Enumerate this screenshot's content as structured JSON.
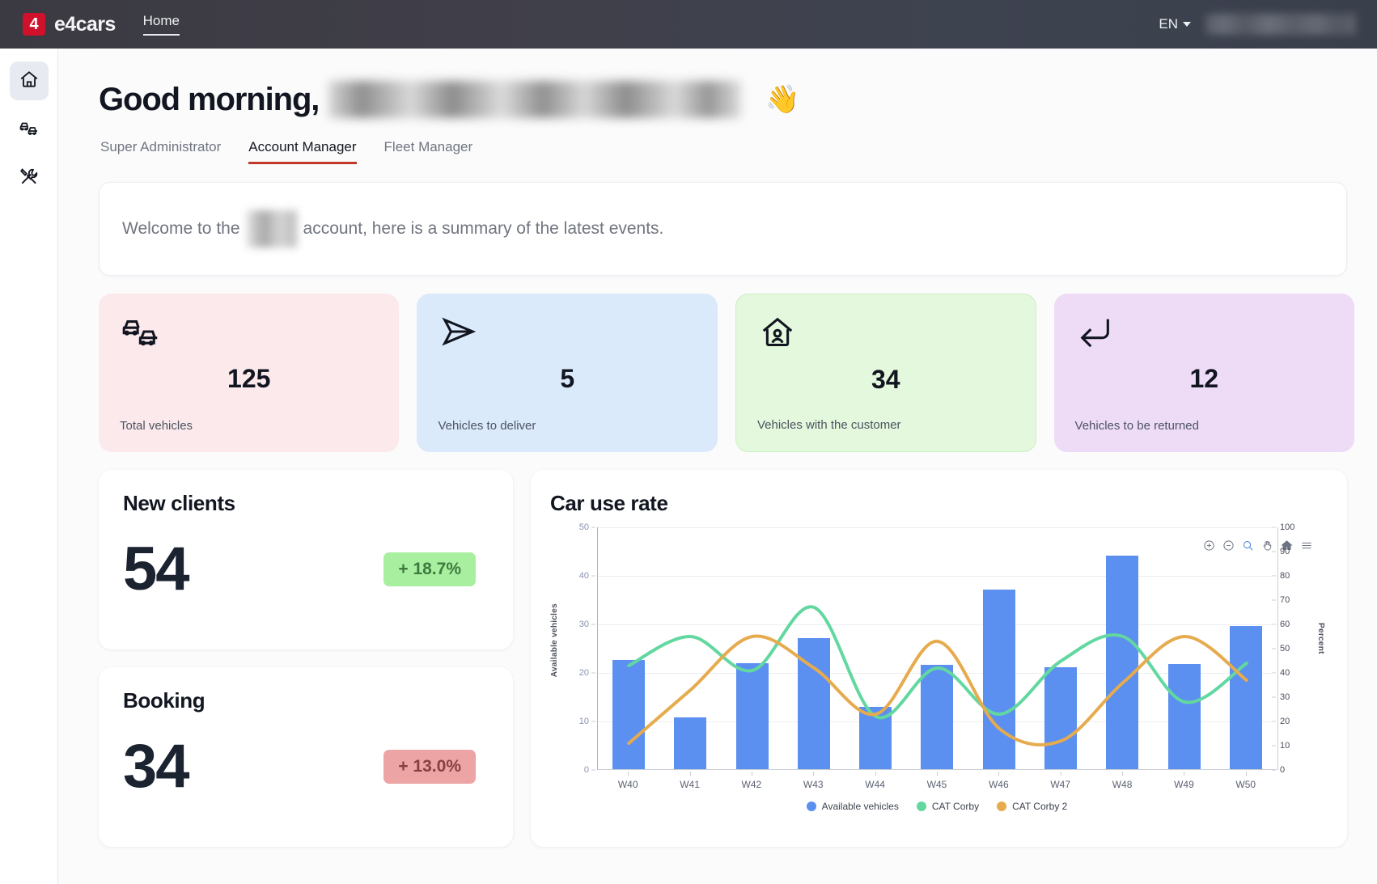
{
  "topbar": {
    "logo_text": "4",
    "brand": "e4cars",
    "nav_home": "Home",
    "language": "EN",
    "user_name_redacted": ""
  },
  "sidebar": {
    "items": [
      {
        "name": "home",
        "icon": "home-icon",
        "active": true
      },
      {
        "name": "vehicles",
        "icon": "cars-icon",
        "active": false
      },
      {
        "name": "tools",
        "icon": "tools-icon",
        "active": false
      }
    ]
  },
  "greeting": {
    "text": "Good morning,",
    "name_redacted": "",
    "wave_emoji": "👋"
  },
  "tabs": [
    {
      "label": "Super Administrator",
      "active": false
    },
    {
      "label": "Account Manager",
      "active": true
    },
    {
      "label": "Fleet Manager",
      "active": false
    }
  ],
  "welcome": {
    "prefix": "Welcome to the",
    "account_redacted": "",
    "suffix": "account, here is a summary of the latest events."
  },
  "kpis": [
    {
      "value": "125",
      "label": "Total vehicles",
      "icon": "cars-icon",
      "color": "#fbe9ec"
    },
    {
      "value": "5",
      "label": "Vehicles to deliver",
      "icon": "send-icon",
      "color": "#dbeafb"
    },
    {
      "value": "34",
      "label": "Vehicles with the customer",
      "icon": "home-person-icon",
      "color": "#e3f8dd"
    },
    {
      "value": "12",
      "label": "Vehicles to be returned",
      "icon": "return-icon",
      "color": "#eedcf7"
    }
  ],
  "stats": [
    {
      "title": "New clients",
      "value": "54",
      "delta": "+ 18.7%",
      "trend": "up"
    },
    {
      "title": "Booking",
      "value": "34",
      "delta": "+ 13.0%",
      "trend": "down"
    }
  ],
  "chart_card": {
    "title": "Car use rate",
    "toolbar": [
      {
        "name": "zoom-in-icon",
        "label": "Zoom In"
      },
      {
        "name": "zoom-out-icon",
        "label": "Zoom Out"
      },
      {
        "name": "selection-zoom-icon",
        "label": "Selection Zoom"
      },
      {
        "name": "panning-icon",
        "label": "Panning"
      },
      {
        "name": "reset-home-icon",
        "label": "Reset Zoom"
      },
      {
        "name": "menu-icon",
        "label": "Menu"
      }
    ]
  },
  "chart_data": {
    "type": "bar",
    "title": "Car use rate",
    "xlabel": "",
    "ylabel": "Available vehicles",
    "y2label": "Percent",
    "ylim": [
      0,
      50
    ],
    "y2lim": [
      0,
      100
    ],
    "yticks": [
      0,
      10,
      20,
      30,
      40,
      50
    ],
    "y2ticks": [
      0,
      10,
      20,
      30,
      40,
      50,
      60,
      70,
      80,
      90,
      100
    ],
    "grid": true,
    "legend_position": "bottom",
    "categories": [
      "W40",
      "W41",
      "W42",
      "W43",
      "W44",
      "W45",
      "W46",
      "W47",
      "W48",
      "W49",
      "W50"
    ],
    "series": [
      {
        "name": "Available vehicles",
        "type": "bar",
        "axis": "left",
        "color": "#5b8ff0",
        "values": [
          22.5,
          10.7,
          21.8,
          27.0,
          12.8,
          21.5,
          37.0,
          21.0,
          44.0,
          21.6,
          29.5
        ]
      },
      {
        "name": "CAT Corby",
        "type": "line",
        "axis": "right",
        "color": "#62d8a0",
        "values": [
          43,
          55,
          41,
          67,
          22,
          42,
          23,
          45,
          55,
          28,
          44
        ]
      },
      {
        "name": "CAT Corby 2",
        "type": "line",
        "axis": "right",
        "color": "#e6ab4e",
        "values": [
          11,
          33,
          55,
          42,
          23,
          53,
          17,
          12,
          36,
          55,
          37
        ]
      }
    ]
  }
}
